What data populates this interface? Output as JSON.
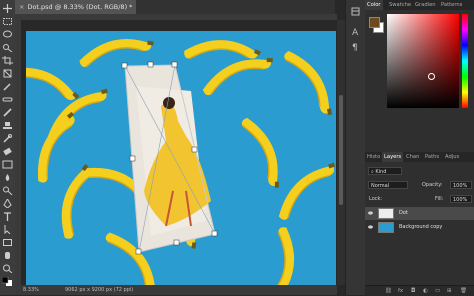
{
  "document": {
    "tab_title": "Dot.psd @ 8.33% (Dot, RGB/8) *",
    "close_glyph": "×"
  },
  "status_bar": {
    "zoom": "8.33%",
    "doc_info": "9062 px x 9200 px (72 ppi)"
  },
  "color_panel": {
    "tabs": [
      "Color",
      "Swatche",
      "Gradien",
      "Patterns"
    ],
    "active_tab": "Color",
    "foreground": "#6b4a1e",
    "background": "#ffffff"
  },
  "layers_panel": {
    "tabs": [
      "Histo",
      "Layers",
      "Chan",
      "Paths",
      "Adjus"
    ],
    "active_tab": "Layers",
    "filter_kind": "Kind",
    "blend_mode": "Normal",
    "opacity_label": "Opacity:",
    "opacity_value": "100%",
    "lock_label": "Lock:",
    "fill_label": "Fill:",
    "fill_value": "100%",
    "layers": [
      {
        "name": "Dot",
        "selected": true
      },
      {
        "name": "Background copy",
        "selected": false
      }
    ],
    "bottom_icons": [
      "link-icon",
      "fx-icon",
      "mask-icon",
      "adjustment-icon",
      "group-icon",
      "new-layer-icon",
      "delete-icon"
    ]
  },
  "colors": {
    "canvas_bg": "#2a9ccf",
    "banana": "#f5cf1d",
    "ui_dark": "#2f2f2f"
  }
}
